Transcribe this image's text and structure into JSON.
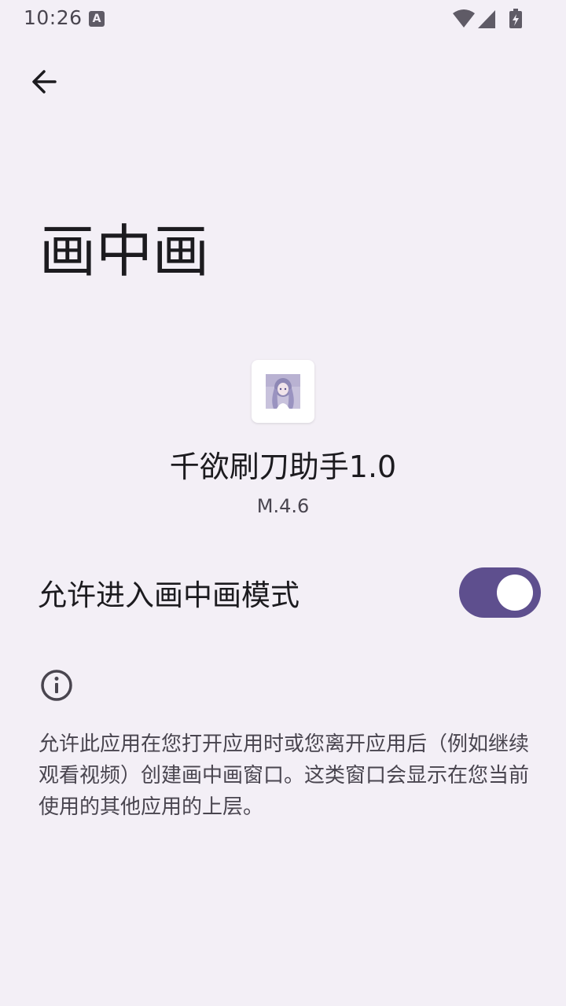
{
  "status_bar": {
    "time": "10:26",
    "notification_icon": "a-notification-icon",
    "icons": [
      "wifi-icon",
      "cellular-signal-icon",
      "battery-charging-icon"
    ]
  },
  "toolbar": {
    "back_icon": "arrow-back-icon"
  },
  "page": {
    "title": "画中画"
  },
  "app": {
    "icon": "app-avatar-icon",
    "name": "千欲刷刀助手1.0",
    "version": "M.4.6"
  },
  "setting": {
    "label": "允许进入画中画模式",
    "enabled": true
  },
  "info": {
    "icon": "info-icon",
    "description": "允许此应用在您打开应用时或您离开应用后（例如继续观看视频）创建画中画窗口。这类窗口会显示在您当前使用的其他应用的上层。"
  },
  "colors": {
    "background": "#f3eff6",
    "toggle_track": "#5e4f8e",
    "toggle_thumb": "#ffffff",
    "primary_text": "#1c1b1f",
    "secondary_text": "#49454f"
  }
}
